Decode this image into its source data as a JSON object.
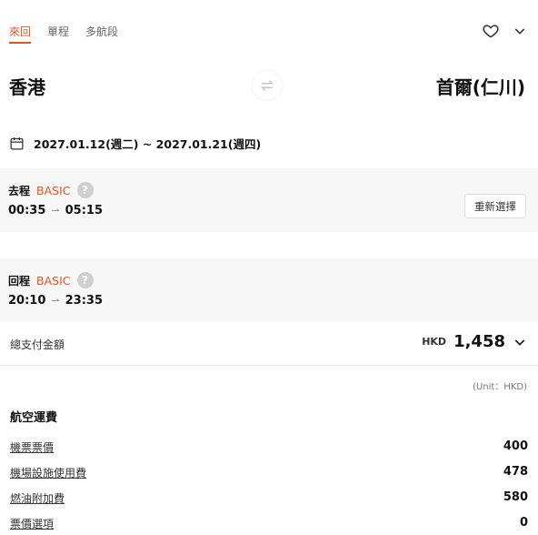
{
  "tabs": [
    {
      "label": "來回",
      "active": true
    },
    {
      "label": "單程",
      "active": false
    },
    {
      "label": "多航段",
      "active": false
    }
  ],
  "icons": {
    "favorite": "heart-outline-icon",
    "expand": "chevron-down-icon",
    "swap": "swap-arrows-icon",
    "calendar": "calendar-icon"
  },
  "route": {
    "from": "香港",
    "to": "首爾(仁川)"
  },
  "dates": {
    "text": "2027.01.12(週二) ~ 2027.01.21(週四)"
  },
  "outbound": {
    "label": "去程",
    "fare_class": "BASIC",
    "help": "?",
    "depart": "00:35",
    "arrive": "05:15",
    "reselect_label": "重新選擇"
  },
  "return": {
    "label": "回程",
    "fare_class": "BASIC",
    "help": "?",
    "depart": "20:10",
    "arrive": "23:35"
  },
  "total": {
    "label": "總支付金額",
    "currency": "HKD",
    "amount": "1,458"
  },
  "unit_note": "(Unit：HKD)",
  "fees": {
    "title": "航空運費",
    "items": [
      {
        "name": "機票票價",
        "value": "400"
      },
      {
        "name": "機場設施使用費",
        "value": "478"
      },
      {
        "name": "燃油附加費",
        "value": "580"
      },
      {
        "name": "票價選項",
        "value": "0"
      }
    ]
  },
  "colors": {
    "accent": "#e8521f",
    "panel": "#f7f7f7"
  }
}
